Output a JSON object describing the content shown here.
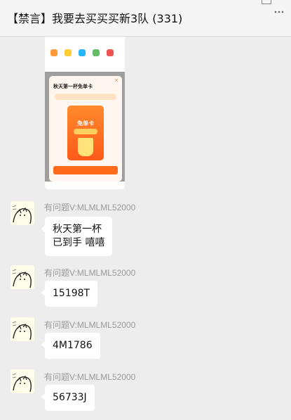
{
  "chat": {
    "title": "【禁言】我要去买买买新3队 (331)"
  },
  "image_message": {
    "modal_title": "秋天第一杯免单卡",
    "card_title": "免单卡"
  },
  "messages": [
    {
      "sender": "有问题V:MLMLML52000",
      "lines": [
        "秋天第一杯",
        "已到手 嘻嘻"
      ]
    },
    {
      "sender": "有问题V:MLMLML52000",
      "lines": [
        "15198T"
      ]
    },
    {
      "sender": "有问题V:MLMLML52000",
      "lines": [
        "4M1786"
      ]
    },
    {
      "sender": "有问题V:MLMLML52000",
      "lines": [
        "56733J"
      ]
    }
  ],
  "colors": {
    "accent_orange": "#ff6a1a",
    "chat_bg": "#ededed",
    "bubble_bg": "#ffffff"
  }
}
